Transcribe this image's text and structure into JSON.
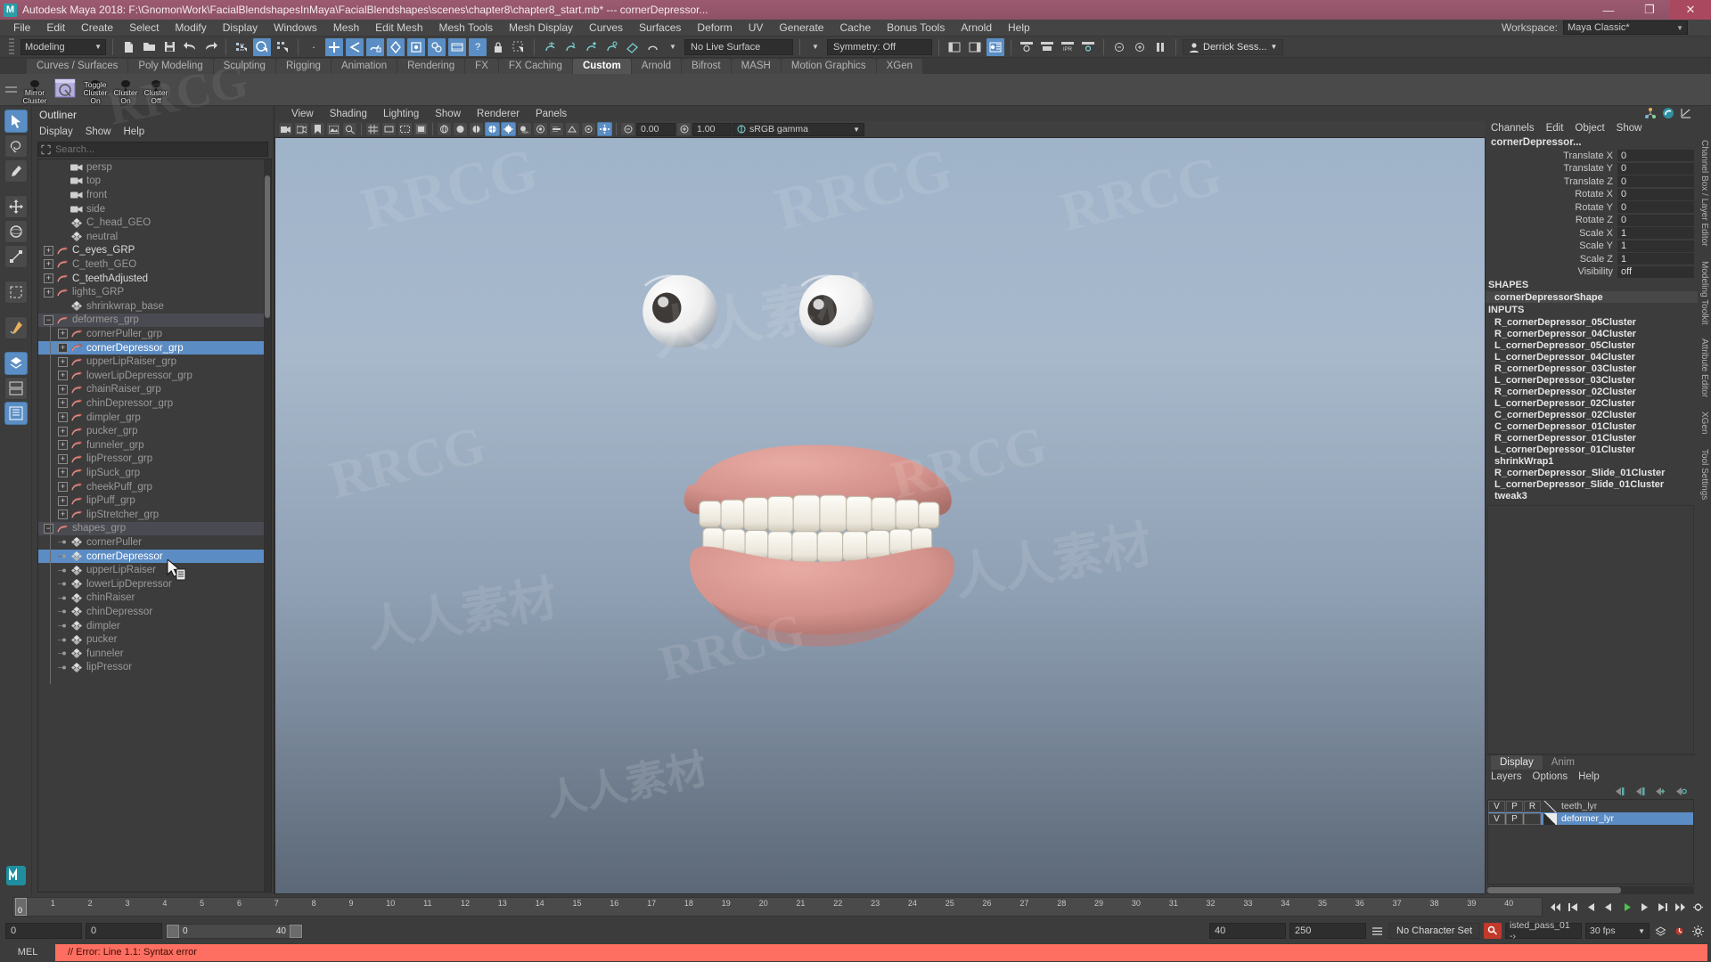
{
  "window": {
    "title": "Autodesk Maya 2018: F:\\GnomonWork\\FacialBlendshapesInMaya\\FacialBlendshapes\\scenes\\chapter8\\chapter8_start.mb*  ---  cornerDepressor...",
    "logo": "M",
    "minimize": "—",
    "maximize": "❐",
    "close": "✕",
    "titlebar_color": "#8e5165",
    "accent_blue": "#5b8cc4"
  },
  "menubar": {
    "items": [
      "File",
      "Edit",
      "Create",
      "Select",
      "Modify",
      "Display",
      "Windows",
      "Mesh",
      "Edit Mesh",
      "Mesh Tools",
      "Mesh Display",
      "Curves",
      "Surfaces",
      "Deform",
      "UV",
      "Generate",
      "Cache",
      "Bonus Tools",
      "Arnold",
      "Help"
    ],
    "workspace_label": "Workspace:",
    "workspace_value": "Maya Classic*"
  },
  "statusline": {
    "mode": "Modeling",
    "live_surface": "No Live Surface",
    "symmetry": "Symmetry: Off",
    "user": "Derrick Sess...",
    "field_a": "0.00",
    "field_b": "1.00"
  },
  "shelf": {
    "tabs": [
      "Curves / Surfaces",
      "Poly Modeling",
      "Sculpting",
      "Rigging",
      "Animation",
      "Rendering",
      "FX",
      "FX Caching",
      "Custom",
      "Arnold",
      "Bifrost",
      "MASH",
      "Motion Graphics",
      "XGen"
    ],
    "active_tab": "Custom",
    "buttons": [
      {
        "label": "Mirror Cluster",
        "icon": "mirror-cluster-icon"
      },
      {
        "label": "",
        "icon": "paint-cluster-icon"
      },
      {
        "label": "Toggle Cluster On",
        "icon": "toggle-cluster-on-icon"
      },
      {
        "label": "Cluster On",
        "icon": "cluster-on-icon"
      },
      {
        "label": "Cluster Off",
        "icon": "cluster-off-icon"
      }
    ]
  },
  "outliner": {
    "title": "Outliner",
    "menu": [
      "Display",
      "Show",
      "Help"
    ],
    "search_placeholder": "Search...",
    "rows": [
      {
        "label": "persp",
        "icon": "camera-icon",
        "indent": 1,
        "expander": "none",
        "state": "dim"
      },
      {
        "label": "top",
        "icon": "camera-icon",
        "indent": 1,
        "expander": "none",
        "state": "dim"
      },
      {
        "label": "front",
        "icon": "camera-icon",
        "indent": 1,
        "expander": "none",
        "state": "dim"
      },
      {
        "label": "side",
        "icon": "camera-icon",
        "indent": 1,
        "expander": "none",
        "state": "dim"
      },
      {
        "label": "C_head_GEO",
        "icon": "mesh-icon",
        "indent": 1,
        "expander": "none",
        "state": "dim"
      },
      {
        "label": "neutral",
        "icon": "mesh-icon",
        "indent": 1,
        "expander": "none",
        "state": "dim"
      },
      {
        "label": "C_eyes_GRP",
        "icon": "group-icon",
        "indent": 0,
        "expander": "plus",
        "state": "bright"
      },
      {
        "label": "C_teeth_GEO",
        "icon": "group-icon",
        "indent": 0,
        "expander": "plus",
        "state": "dim"
      },
      {
        "label": "C_teethAdjusted",
        "icon": "group-icon",
        "indent": 0,
        "expander": "plus",
        "state": "bright"
      },
      {
        "label": "lights_GRP",
        "icon": "group-icon",
        "indent": 0,
        "expander": "plus",
        "state": "dim"
      },
      {
        "label": "shrinkwrap_base",
        "icon": "mesh-icon",
        "indent": 1,
        "expander": "none",
        "state": "dim"
      },
      {
        "label": "deformers_grp",
        "icon": "group-icon",
        "indent": 0,
        "expander": "minus",
        "state": "hl"
      },
      {
        "label": "cornerPuller_grp",
        "icon": "group-icon",
        "indent": 1,
        "expander": "plus",
        "state": "dim"
      },
      {
        "label": "cornerDepressor_grp",
        "icon": "group-icon",
        "indent": 1,
        "expander": "plus",
        "state": "selected"
      },
      {
        "label": "upperLipRaiser_grp",
        "icon": "group-icon",
        "indent": 1,
        "expander": "plus",
        "state": "dim"
      },
      {
        "label": "lowerLipDepressor_grp",
        "icon": "group-icon",
        "indent": 1,
        "expander": "plus",
        "state": "dim"
      },
      {
        "label": "chainRaiser_grp",
        "icon": "group-icon",
        "indent": 1,
        "expander": "plus",
        "state": "dim"
      },
      {
        "label": "chinDepressor_grp",
        "icon": "group-icon",
        "indent": 1,
        "expander": "plus",
        "state": "dim"
      },
      {
        "label": "dimpler_grp",
        "icon": "group-icon",
        "indent": 1,
        "expander": "plus",
        "state": "dim"
      },
      {
        "label": "pucker_grp",
        "icon": "group-icon",
        "indent": 1,
        "expander": "plus",
        "state": "dim"
      },
      {
        "label": "funneler_grp",
        "icon": "group-icon",
        "indent": 1,
        "expander": "plus",
        "state": "dim"
      },
      {
        "label": "lipPressor_grp",
        "icon": "group-icon",
        "indent": 1,
        "expander": "plus",
        "state": "dim"
      },
      {
        "label": "lipSuck_grp",
        "icon": "group-icon",
        "indent": 1,
        "expander": "plus",
        "state": "dim"
      },
      {
        "label": "cheekPuff_grp",
        "icon": "group-icon",
        "indent": 1,
        "expander": "plus",
        "state": "dim"
      },
      {
        "label": "lipPuff_grp",
        "icon": "group-icon",
        "indent": 1,
        "expander": "plus",
        "state": "dim"
      },
      {
        "label": "lipStretcher_grp",
        "icon": "group-icon",
        "indent": 1,
        "expander": "plus",
        "state": "dim"
      },
      {
        "label": "shapes_grp",
        "icon": "group-icon",
        "indent": 0,
        "expander": "minus",
        "state": "hl"
      },
      {
        "label": "cornerPuller",
        "icon": "mesh-icon",
        "indent": 1,
        "expander": "dot",
        "state": "dim"
      },
      {
        "label": "cornerDepressor",
        "icon": "mesh-icon",
        "indent": 1,
        "expander": "dot",
        "state": "selected"
      },
      {
        "label": "upperLipRaiser",
        "icon": "mesh-icon",
        "indent": 1,
        "expander": "dot",
        "state": "dim"
      },
      {
        "label": "lowerLipDepressor",
        "icon": "mesh-icon",
        "indent": 1,
        "expander": "dot",
        "state": "dim"
      },
      {
        "label": "chinRaiser",
        "icon": "mesh-icon",
        "indent": 1,
        "expander": "dot",
        "state": "dim"
      },
      {
        "label": "chinDepressor",
        "icon": "mesh-icon",
        "indent": 1,
        "expander": "dot",
        "state": "dim"
      },
      {
        "label": "dimpler",
        "icon": "mesh-icon",
        "indent": 1,
        "expander": "dot",
        "state": "dim"
      },
      {
        "label": "pucker",
        "icon": "mesh-icon",
        "indent": 1,
        "expander": "dot",
        "state": "dim"
      },
      {
        "label": "funneler",
        "icon": "mesh-icon",
        "indent": 1,
        "expander": "dot",
        "state": "dim"
      },
      {
        "label": "lipPressor",
        "icon": "mesh-icon",
        "indent": 1,
        "expander": "dot",
        "state": "dim"
      }
    ]
  },
  "viewport": {
    "menu": [
      "View",
      "Shading",
      "Lighting",
      "Show",
      "Renderer",
      "Panels"
    ],
    "exposure": "0.00",
    "gamma": "1.00",
    "colorspace": "sRGB gamma"
  },
  "channelbox": {
    "menu": [
      "Channels",
      "Edit",
      "Object",
      "Show"
    ],
    "object_name": "cornerDepressor...",
    "attributes": [
      {
        "name": "Translate X",
        "value": "0"
      },
      {
        "name": "Translate Y",
        "value": "0"
      },
      {
        "name": "Translate Z",
        "value": "0"
      },
      {
        "name": "Rotate X",
        "value": "0"
      },
      {
        "name": "Rotate Y",
        "value": "0"
      },
      {
        "name": "Rotate Z",
        "value": "0"
      },
      {
        "name": "Scale X",
        "value": "1"
      },
      {
        "name": "Scale Y",
        "value": "1"
      },
      {
        "name": "Scale Z",
        "value": "1"
      },
      {
        "name": "Visibility",
        "value": "off"
      }
    ],
    "shapes_header": "SHAPES",
    "shapes": [
      "cornerDepressorShape"
    ],
    "inputs_header": "INPUTS",
    "inputs": [
      "R_cornerDepressor_05Cluster",
      "R_cornerDepressor_04Cluster",
      "L_cornerDepressor_05Cluster",
      "L_cornerDepressor_04Cluster",
      "R_cornerDepressor_03Cluster",
      "L_cornerDepressor_03Cluster",
      "R_cornerDepressor_02Cluster",
      "L_cornerDepressor_02Cluster",
      "C_cornerDepressor_02Cluster",
      "C_cornerDepressor_01Cluster",
      "R_cornerDepressor_01Cluster",
      "L_cornerDepressor_01Cluster",
      "shrinkWrap1",
      "R_cornerDepressor_Slide_01Cluster",
      "L_cornerDepressor_Slide_01Cluster",
      "tweak3"
    ]
  },
  "layers": {
    "tabs": [
      "Display",
      "Anim"
    ],
    "active_tab": "Display",
    "menu": [
      "Layers",
      "Options",
      "Help"
    ],
    "rows": [
      {
        "v": "V",
        "p": "P",
        "r": "R",
        "name": "teeth_lyr",
        "selected": false
      },
      {
        "v": "V",
        "p": "P",
        "r": "",
        "name": "deformer_lyr",
        "selected": true
      }
    ]
  },
  "right_tabs": [
    "Channel Box / Layer Editor",
    "Modeling Toolkit",
    "Attribute Editor",
    "XGen",
    "Tool Settings"
  ],
  "timeline": {
    "ticks": [
      "1",
      "2",
      "3",
      "4",
      "5",
      "6",
      "7",
      "8",
      "9",
      "10",
      "11",
      "12",
      "13",
      "14",
      "15",
      "16",
      "17",
      "18",
      "19",
      "20",
      "21",
      "22",
      "23",
      "24",
      "25",
      "26",
      "27",
      "28",
      "29",
      "30",
      "31",
      "32",
      "33",
      "34",
      "35",
      "36",
      "37",
      "38",
      "39",
      "40"
    ],
    "current_frame": "0",
    "start_display": "0"
  },
  "range": {
    "start": "0",
    "start2": "0",
    "range_min": "0",
    "range_max": "40",
    "anim_end": "40",
    "playback_end": "250",
    "character_set": "No Character Set",
    "selection_set": "isted_pass_01 -›",
    "fps": "30 fps"
  },
  "command": {
    "mel_label": "MEL",
    "error_text": "// Error: Line 1.1: Syntax error"
  },
  "watermarks": [
    "RRCG",
    "人人素材"
  ]
}
